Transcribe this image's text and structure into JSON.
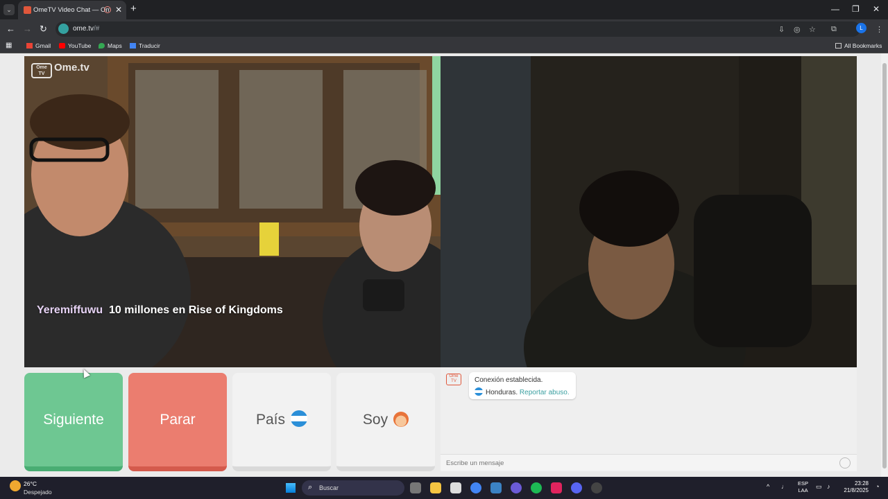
{
  "browser": {
    "tab_title": "OmeTV Video Chat — Omegle",
    "url_host": "ome.tv",
    "url_path": "/#",
    "bookmarks": [
      "Gmail",
      "YouTube",
      "Maps",
      "Traducir"
    ],
    "all_bookmarks": "All Bookmarks",
    "profile_initial": "L"
  },
  "video": {
    "logo": "Ome.tv",
    "logo_small": "Ome TV",
    "overlay_name": "Yeremiffuwu",
    "overlay_message": "10 millones en Rise of Kingdoms"
  },
  "controls": {
    "next": "Siguiente",
    "stop": "Parar",
    "country": "País",
    "gender": "Soy"
  },
  "chat": {
    "connection": "Conexión establecida.",
    "country_name": "Honduras.",
    "report": "Reportar abuso.",
    "placeholder": "Escribe un mensaje"
  },
  "taskbar": {
    "temperature": "26°C",
    "weather": "Despejado",
    "search": "Buscar",
    "lang_line1": "ESP",
    "lang_line2": "LAA",
    "time": "23:28",
    "date": "21/8/2025"
  },
  "colors": {
    "next_button": "#6ec792",
    "stop_button": "#eb7d6f",
    "accent_link": "#3a9fa0"
  }
}
